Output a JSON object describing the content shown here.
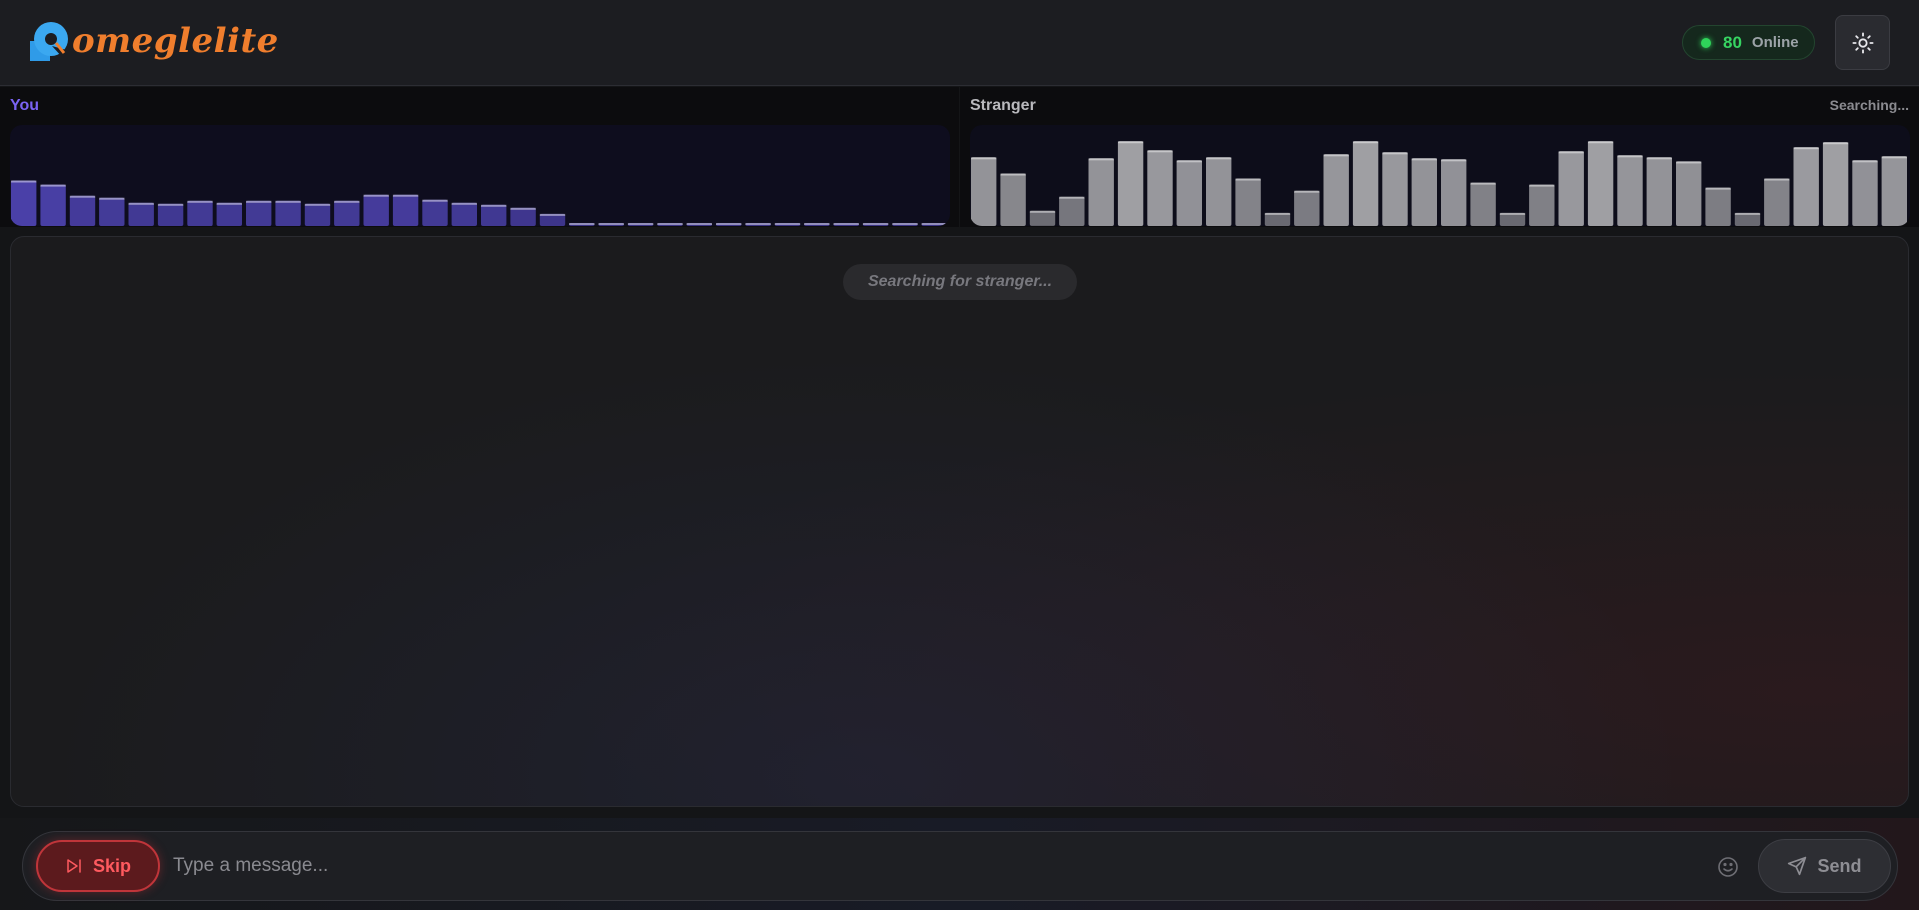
{
  "header": {
    "logo_text": "omeglelite",
    "online": {
      "count": "80",
      "label": "Online"
    },
    "theme_toggle": "sun-icon"
  },
  "visualizer": {
    "you": {
      "label": "You",
      "bar_color": "#5b4fcf",
      "levels": [
        0.45,
        0.41,
        0.3,
        0.28,
        0.23,
        0.22,
        0.25,
        0.23,
        0.25,
        0.25,
        0.22,
        0.25,
        0.31,
        0.31,
        0.26,
        0.23,
        0.21,
        0.18,
        0.12,
        0.03,
        0.03,
        0.03,
        0.03,
        0.03,
        0.03,
        0.03,
        0.03,
        0.03,
        0.03,
        0.03,
        0.03,
        0.03
      ]
    },
    "stranger": {
      "label": "Stranger",
      "status": "Searching...",
      "bar_color": "#a4a4a8",
      "levels": [
        0.68,
        0.52,
        0.15,
        0.29,
        0.67,
        0.84,
        0.75,
        0.65,
        0.68,
        0.47,
        0.13,
        0.35,
        0.71,
        0.84,
        0.73,
        0.67,
        0.66,
        0.43,
        0.13,
        0.41,
        0.74,
        0.84,
        0.7,
        0.68,
        0.64,
        0.38,
        0.13,
        0.47,
        0.78,
        0.83,
        0.65,
        0.69
      ]
    }
  },
  "chat": {
    "status": "Searching for stranger..."
  },
  "controls": {
    "skip_label": "Skip",
    "message_placeholder": "Type a message...",
    "send_label": "Send",
    "skip_color": "#ff5a5f"
  }
}
